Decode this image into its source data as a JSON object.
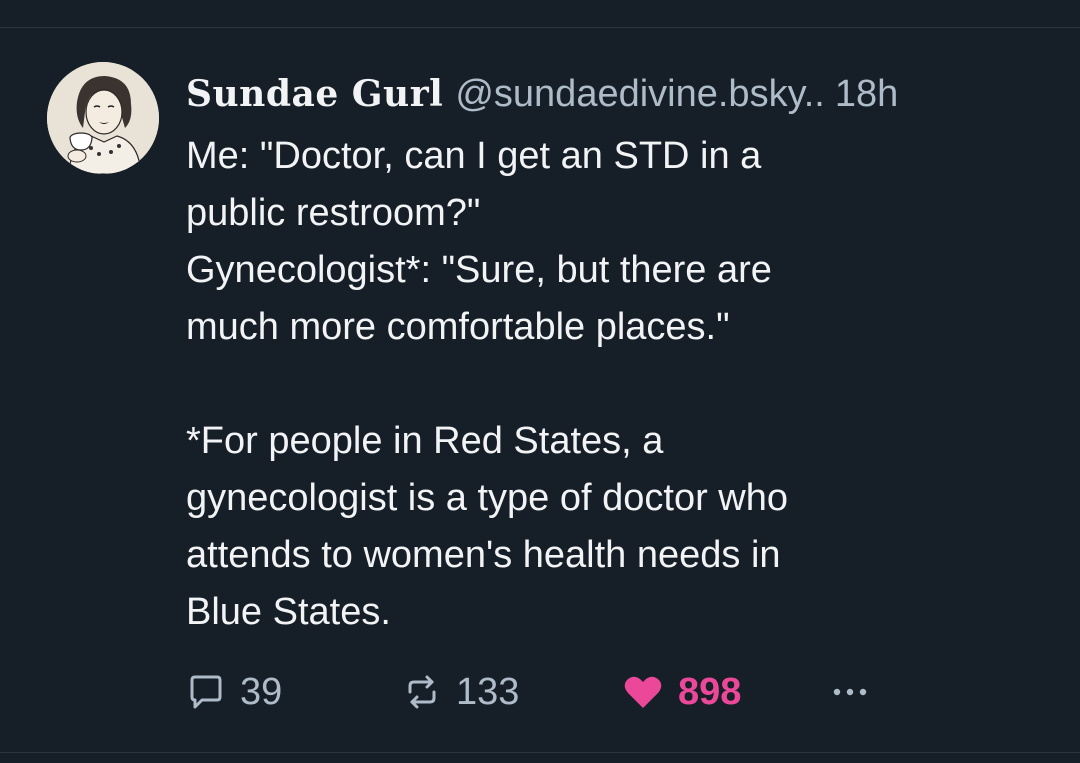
{
  "post": {
    "author": {
      "display_name": "Sundae Gurl",
      "handle": "@sundaedivine.bsky..",
      "timestamp": "18h"
    },
    "text_lines": [
      "Me: \"Doctor, can I get an STD in a",
      "public restroom?\"",
      "Gynecologist*: \"Sure, but there are",
      "much more comfortable places.\"",
      "",
      "*For people in Red States, a",
      "gynecologist is a type of doctor who",
      "attends to women's health needs in",
      "Blue States."
    ],
    "actions": {
      "reply_count": "39",
      "repost_count": "133",
      "like_count": "898",
      "liked": true,
      "like_color": "#ec4899"
    },
    "icons": {
      "reply": "speech-bubble-icon",
      "repost": "repost-arrows-icon",
      "like": "heart-icon",
      "more": "ellipsis-icon"
    }
  }
}
